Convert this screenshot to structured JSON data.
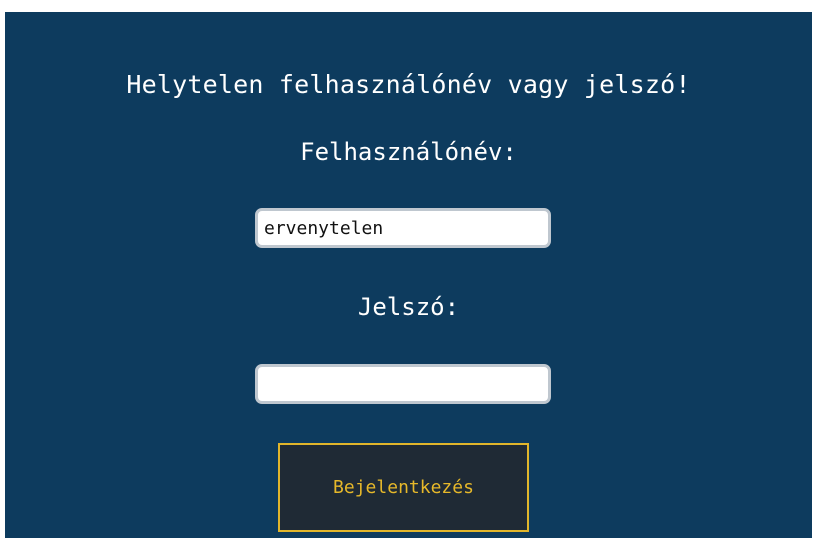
{
  "login": {
    "error_message": "Helytelen felhasználónév vagy jelszó!",
    "username_label": "Felhasználónév:",
    "username_value": "ervenytelen",
    "password_label": "Jelszó:",
    "password_value": "",
    "submit_label": "Bejelentkezés"
  },
  "colors": {
    "panel_background": "#0d3b5e",
    "button_border": "#e0b52b",
    "button_text": "#e6b82a",
    "button_background": "#1f2a35"
  }
}
